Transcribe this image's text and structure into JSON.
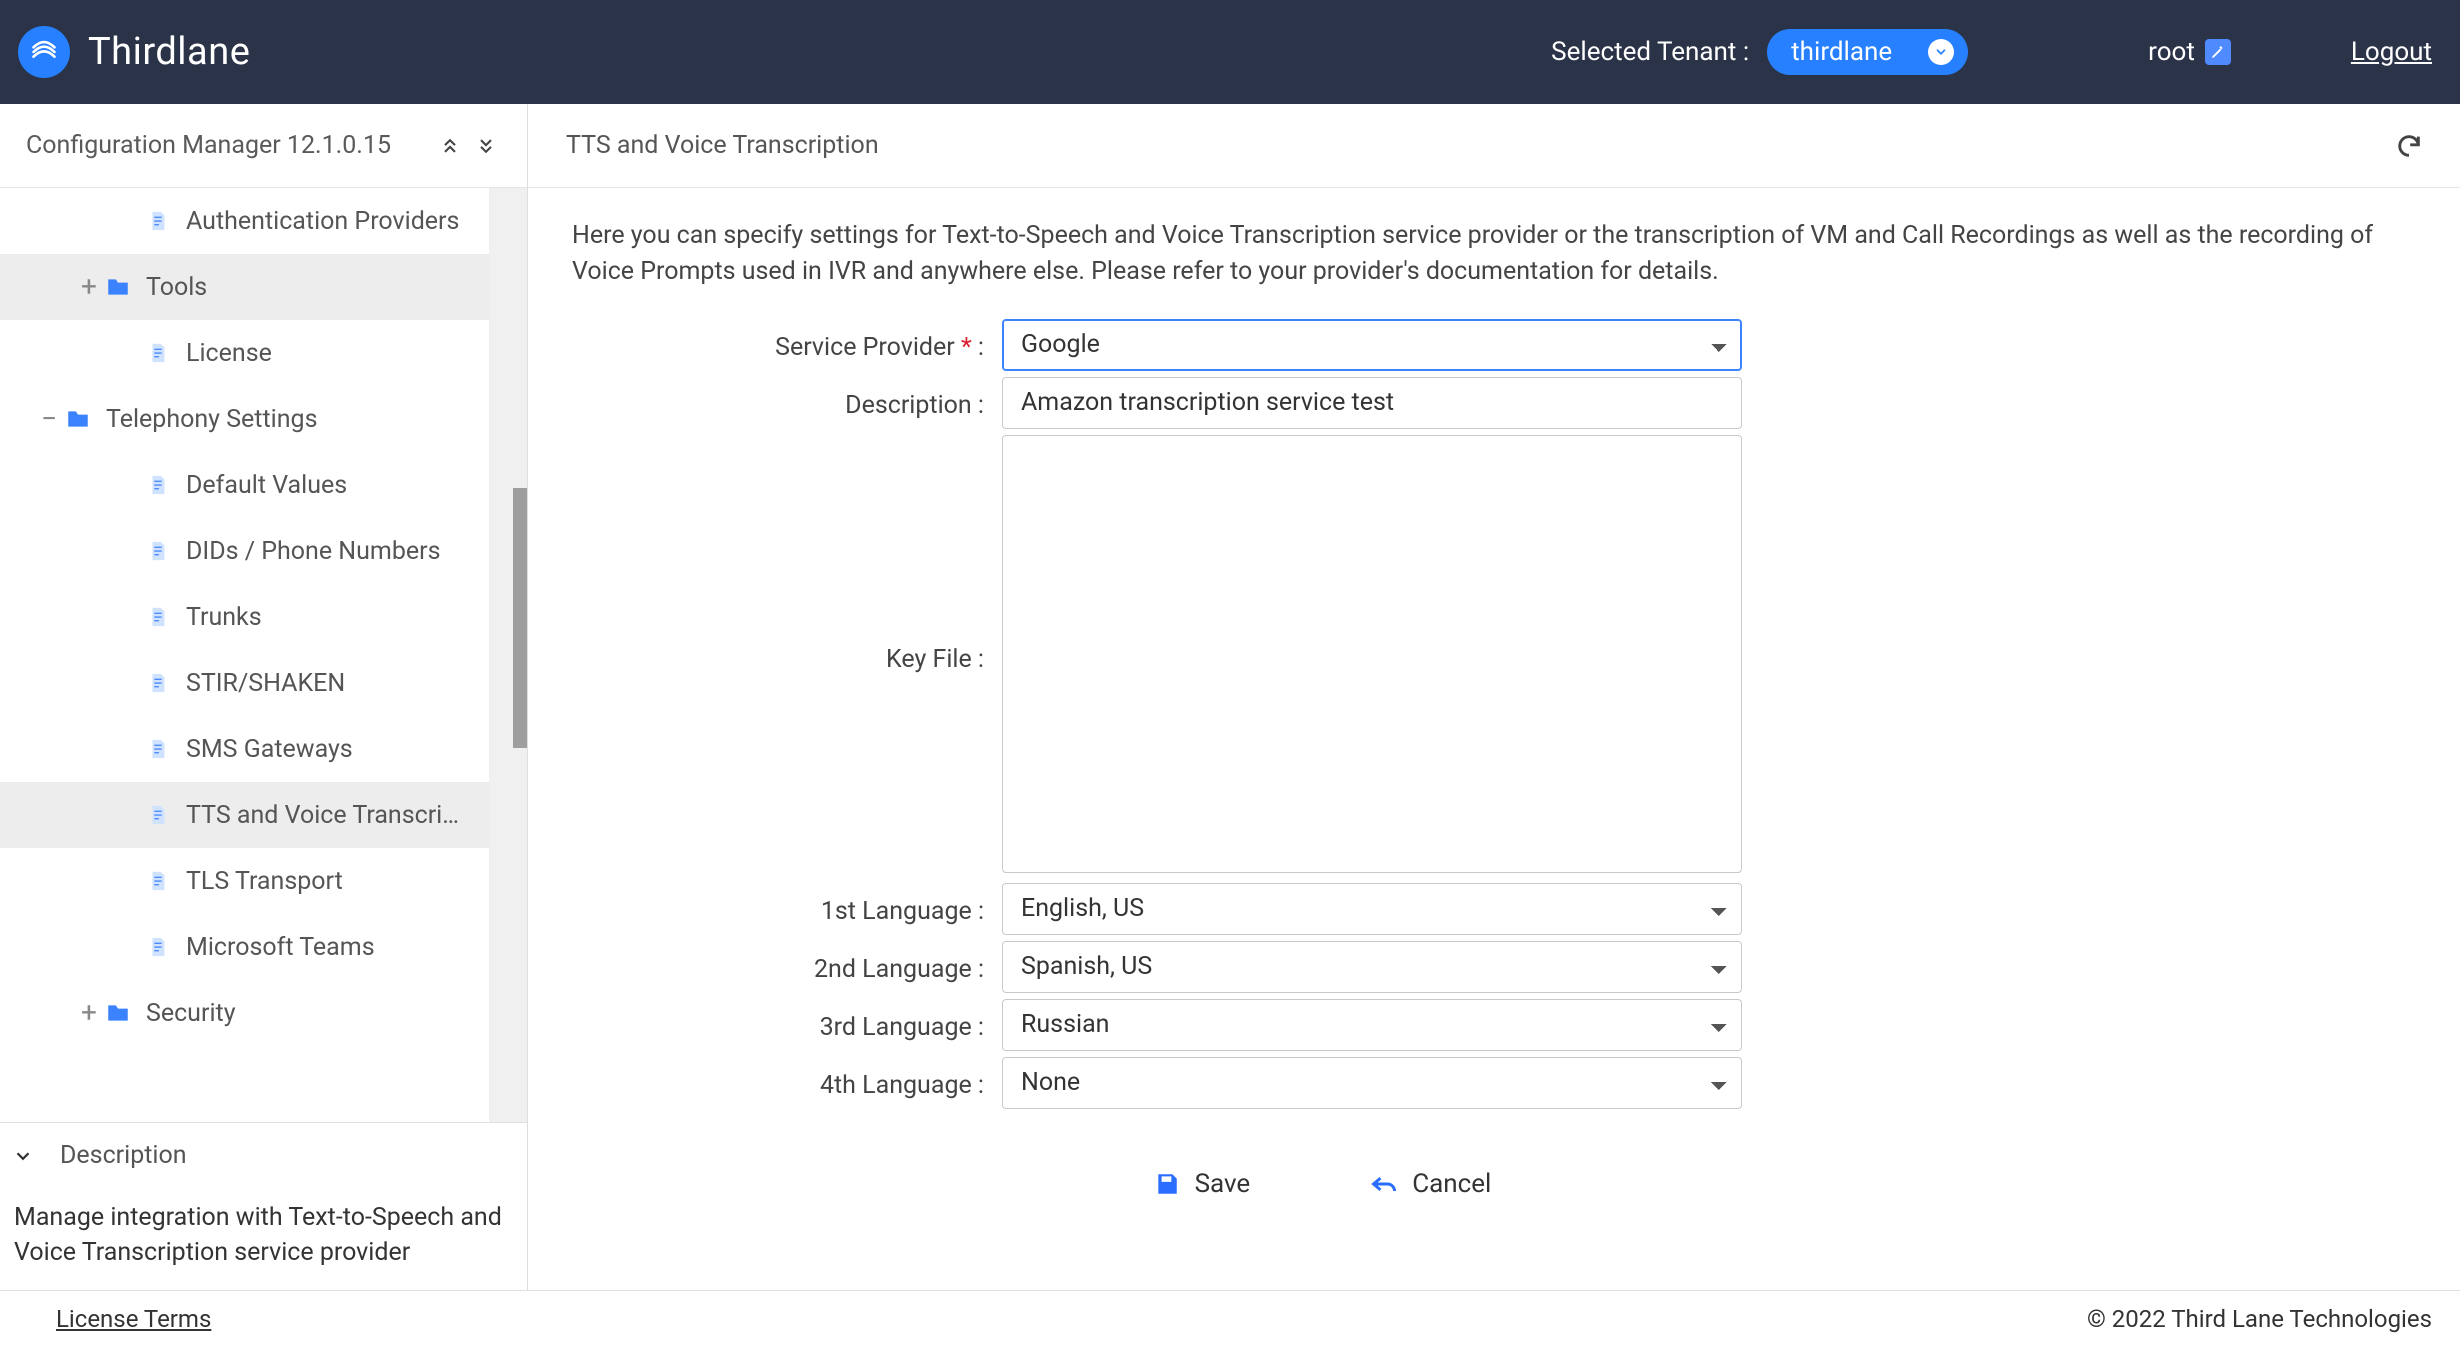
{
  "header": {
    "brand": "Thirdlane",
    "tenant_label": "Selected Tenant :",
    "tenant_value": "thirdlane",
    "user": "root",
    "logout": "Logout"
  },
  "sidebar": {
    "title": "Configuration Manager 12.1.0.15",
    "items": [
      {
        "type": "page",
        "indent": 3,
        "label": "Authentication Providers"
      },
      {
        "type": "folder",
        "indent": 2,
        "toggle": "+",
        "label": "Tools",
        "cls": "folder-tools"
      },
      {
        "type": "page",
        "indent": 3,
        "label": "License"
      },
      {
        "type": "folder",
        "indent": 1,
        "toggle": "−",
        "label": "Telephony Settings"
      },
      {
        "type": "page",
        "indent": 3,
        "label": "Default Values"
      },
      {
        "type": "page",
        "indent": 3,
        "label": "DIDs / Phone Numbers"
      },
      {
        "type": "page",
        "indent": 3,
        "label": "Trunks"
      },
      {
        "type": "page",
        "indent": 3,
        "label": "STIR/SHAKEN"
      },
      {
        "type": "page",
        "indent": 3,
        "label": "SMS Gateways"
      },
      {
        "type": "page",
        "indent": 3,
        "label": "TTS and Voice Transcri…",
        "selected": true
      },
      {
        "type": "page",
        "indent": 3,
        "label": "TLS Transport"
      },
      {
        "type": "page",
        "indent": 3,
        "label": "Microsoft Teams"
      },
      {
        "type": "folder",
        "indent": 2,
        "toggle": "+",
        "label": "Security"
      }
    ],
    "desc_header": "Description",
    "desc_body": "Manage integration with Text-to-Speech and Voice Transcription service provider"
  },
  "main": {
    "title": "TTS and Voice Transcription",
    "intro": "Here you can specify settings for Text-to-Speech and Voice Transcription service provider or the transcription of VM and Call Recordings as well as the recording of Voice Prompts used in IVR and anywhere else. Please refer to your provider's documentation for details.",
    "labels": {
      "service_provider": "Service Provider",
      "description": "Description :",
      "key_file": "Key File :",
      "lang1": "1st Language :",
      "lang2": "2nd Language :",
      "lang3": "3rd Language :",
      "lang4": "4th Language :"
    },
    "values": {
      "service_provider": "Google",
      "description": "Amazon transcription service test",
      "key_file": "",
      "lang1": "English, US",
      "lang2": "Spanish, US",
      "lang3": "Russian",
      "lang4": "None"
    },
    "actions": {
      "save": "Save",
      "cancel": "Cancel"
    }
  },
  "footer": {
    "license": "License Terms",
    "copyright": "© 2022 Third Lane Technologies"
  }
}
